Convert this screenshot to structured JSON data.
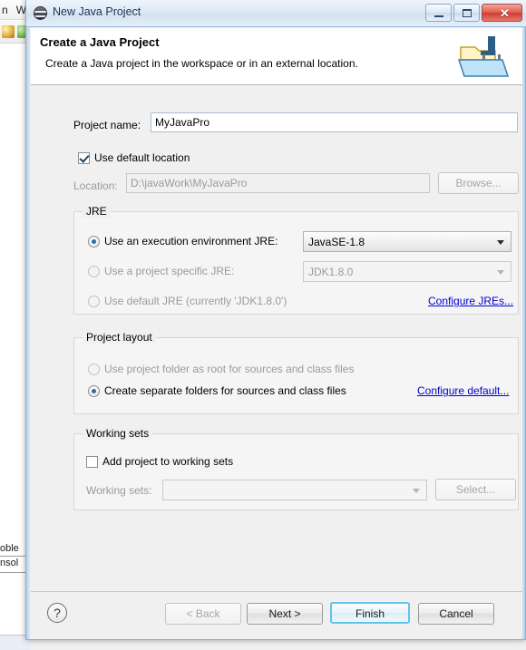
{
  "background": {
    "menu_items": [
      "n",
      "W"
    ],
    "tab_problems": "oble",
    "tab_console": "nsol"
  },
  "window": {
    "title": "New Java Project",
    "icon": "eclipse-icon",
    "minimize_label": "",
    "maximize_label": "",
    "close_label": "✕"
  },
  "header": {
    "title": "Create a Java Project",
    "description": "Create a Java project in the workspace or in an external location.",
    "icon": "java-project-wizard-icon"
  },
  "project": {
    "name_label": "Project name:",
    "name_value": "MyJavaPro",
    "use_default_location_label": "Use default location",
    "use_default_location_checked": true,
    "location_label": "Location:",
    "location_value": "D:\\javaWork\\MyJavaPro",
    "browse_label": "Browse..."
  },
  "jre": {
    "group_title": "JRE",
    "exec_env_label": "Use an execution environment JRE:",
    "exec_env_selected": true,
    "exec_env_value": "JavaSE-1.8",
    "project_specific_label": "Use a project specific JRE:",
    "project_specific_selected": false,
    "project_specific_value": "JDK1.8.0",
    "default_jre_label": "Use default JRE (currently 'JDK1.8.0')",
    "default_jre_selected": false,
    "configure_link": "Configure JREs..."
  },
  "layout": {
    "group_title": "Project layout",
    "root_option_label": "Use project folder as root for sources and class files",
    "root_option_selected": false,
    "separate_option_label": "Create separate folders for sources and class files",
    "separate_option_selected": true,
    "configure_link": "Configure default..."
  },
  "working_sets": {
    "group_title": "Working sets",
    "add_label": "Add project to working sets",
    "add_checked": false,
    "sets_label": "Working sets:",
    "sets_value": "",
    "select_label": "Select..."
  },
  "footer": {
    "help_label": "?",
    "back_label": "< Back",
    "back_enabled": false,
    "next_label": "Next >",
    "finish_label": "Finish",
    "finish_is_default": true,
    "cancel_label": "Cancel"
  },
  "colors": {
    "accent": "#0000d0",
    "default_button_border": "#5fc3ef",
    "close_button": "#cf3c2f",
    "dialog_border": "#8aafd4"
  }
}
